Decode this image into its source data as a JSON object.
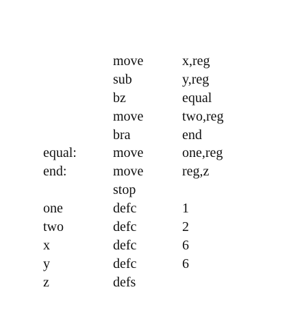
{
  "lines": [
    {
      "label": "",
      "op": "move",
      "arg": "x,reg"
    },
    {
      "label": "",
      "op": "sub",
      "arg": "y,reg"
    },
    {
      "label": "",
      "op": "bz",
      "arg": "equal"
    },
    {
      "label": "",
      "op": "move",
      "arg": "two,reg"
    },
    {
      "label": "",
      "op": "bra",
      "arg": "end"
    },
    {
      "label": "equal:",
      "op": "move",
      "arg": "one,reg"
    },
    {
      "label": "end:",
      "op": "move",
      "arg": "reg,z"
    },
    {
      "label": "",
      "op": "stop",
      "arg": ""
    },
    {
      "label": "one",
      "op": "defc",
      "arg": "1"
    },
    {
      "label": "two",
      "op": "defc",
      "arg": "2"
    },
    {
      "label": "x",
      "op": "defc",
      "arg": "6"
    },
    {
      "label": "y",
      "op": "defc",
      "arg": "6"
    },
    {
      "label": "z",
      "op": "defs",
      "arg": ""
    }
  ]
}
